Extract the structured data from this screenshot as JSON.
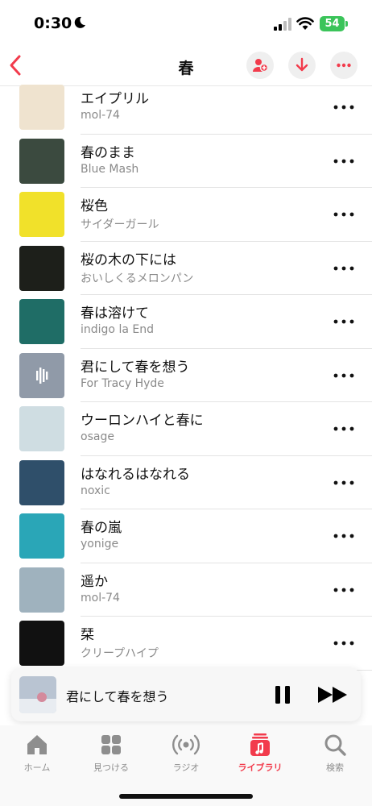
{
  "status_bar": {
    "time": "0:30",
    "battery": "54"
  },
  "nav": {
    "title": "春"
  },
  "tracks": [
    {
      "title": "エイプリル",
      "artist": "mol-74",
      "art_color": "#efe3cf"
    },
    {
      "title": "春のまま",
      "artist": "Blue Mash",
      "art_color": "#3b4a3f"
    },
    {
      "title": "桜色",
      "artist": "サイダーガール",
      "art_color": "#f1e12a"
    },
    {
      "title": "桜の木の下には",
      "artist": "おいしくるメロンパン",
      "art_color": "#1d1f1a"
    },
    {
      "title": "春は溶けて",
      "artist": "indigo la End",
      "art_color": "#1f6d66"
    },
    {
      "title": "君にして春を想う",
      "artist": "For Tracy Hyde",
      "art_color": "#aab6c6"
    },
    {
      "title": "ウーロンハイと春に",
      "artist": "osage",
      "art_color": "#cfdde2"
    },
    {
      "title": "はなれるはなれる",
      "artist": "noxic",
      "art_color": "#2f4f6a"
    },
    {
      "title": "春の嵐",
      "artist": "yonige",
      "art_color": "#2aa6b7"
    },
    {
      "title": "遥か",
      "artist": "mol-74",
      "art_color": "#9fb2be"
    },
    {
      "title": "栞",
      "artist": "クリープハイプ",
      "art_color": "#111111"
    }
  ],
  "now_playing": {
    "title": "君にして春を想う"
  },
  "tabs": [
    {
      "label": "ホーム",
      "icon": "home-icon"
    },
    {
      "label": "見つける",
      "icon": "grid-icon"
    },
    {
      "label": "ラジオ",
      "icon": "radio-icon"
    },
    {
      "label": "ライブラリ",
      "icon": "library-icon"
    },
    {
      "label": "検索",
      "icon": "search-icon"
    }
  ],
  "colors": {
    "accent": "#f23b4c",
    "battery": "#3bc45a"
  }
}
